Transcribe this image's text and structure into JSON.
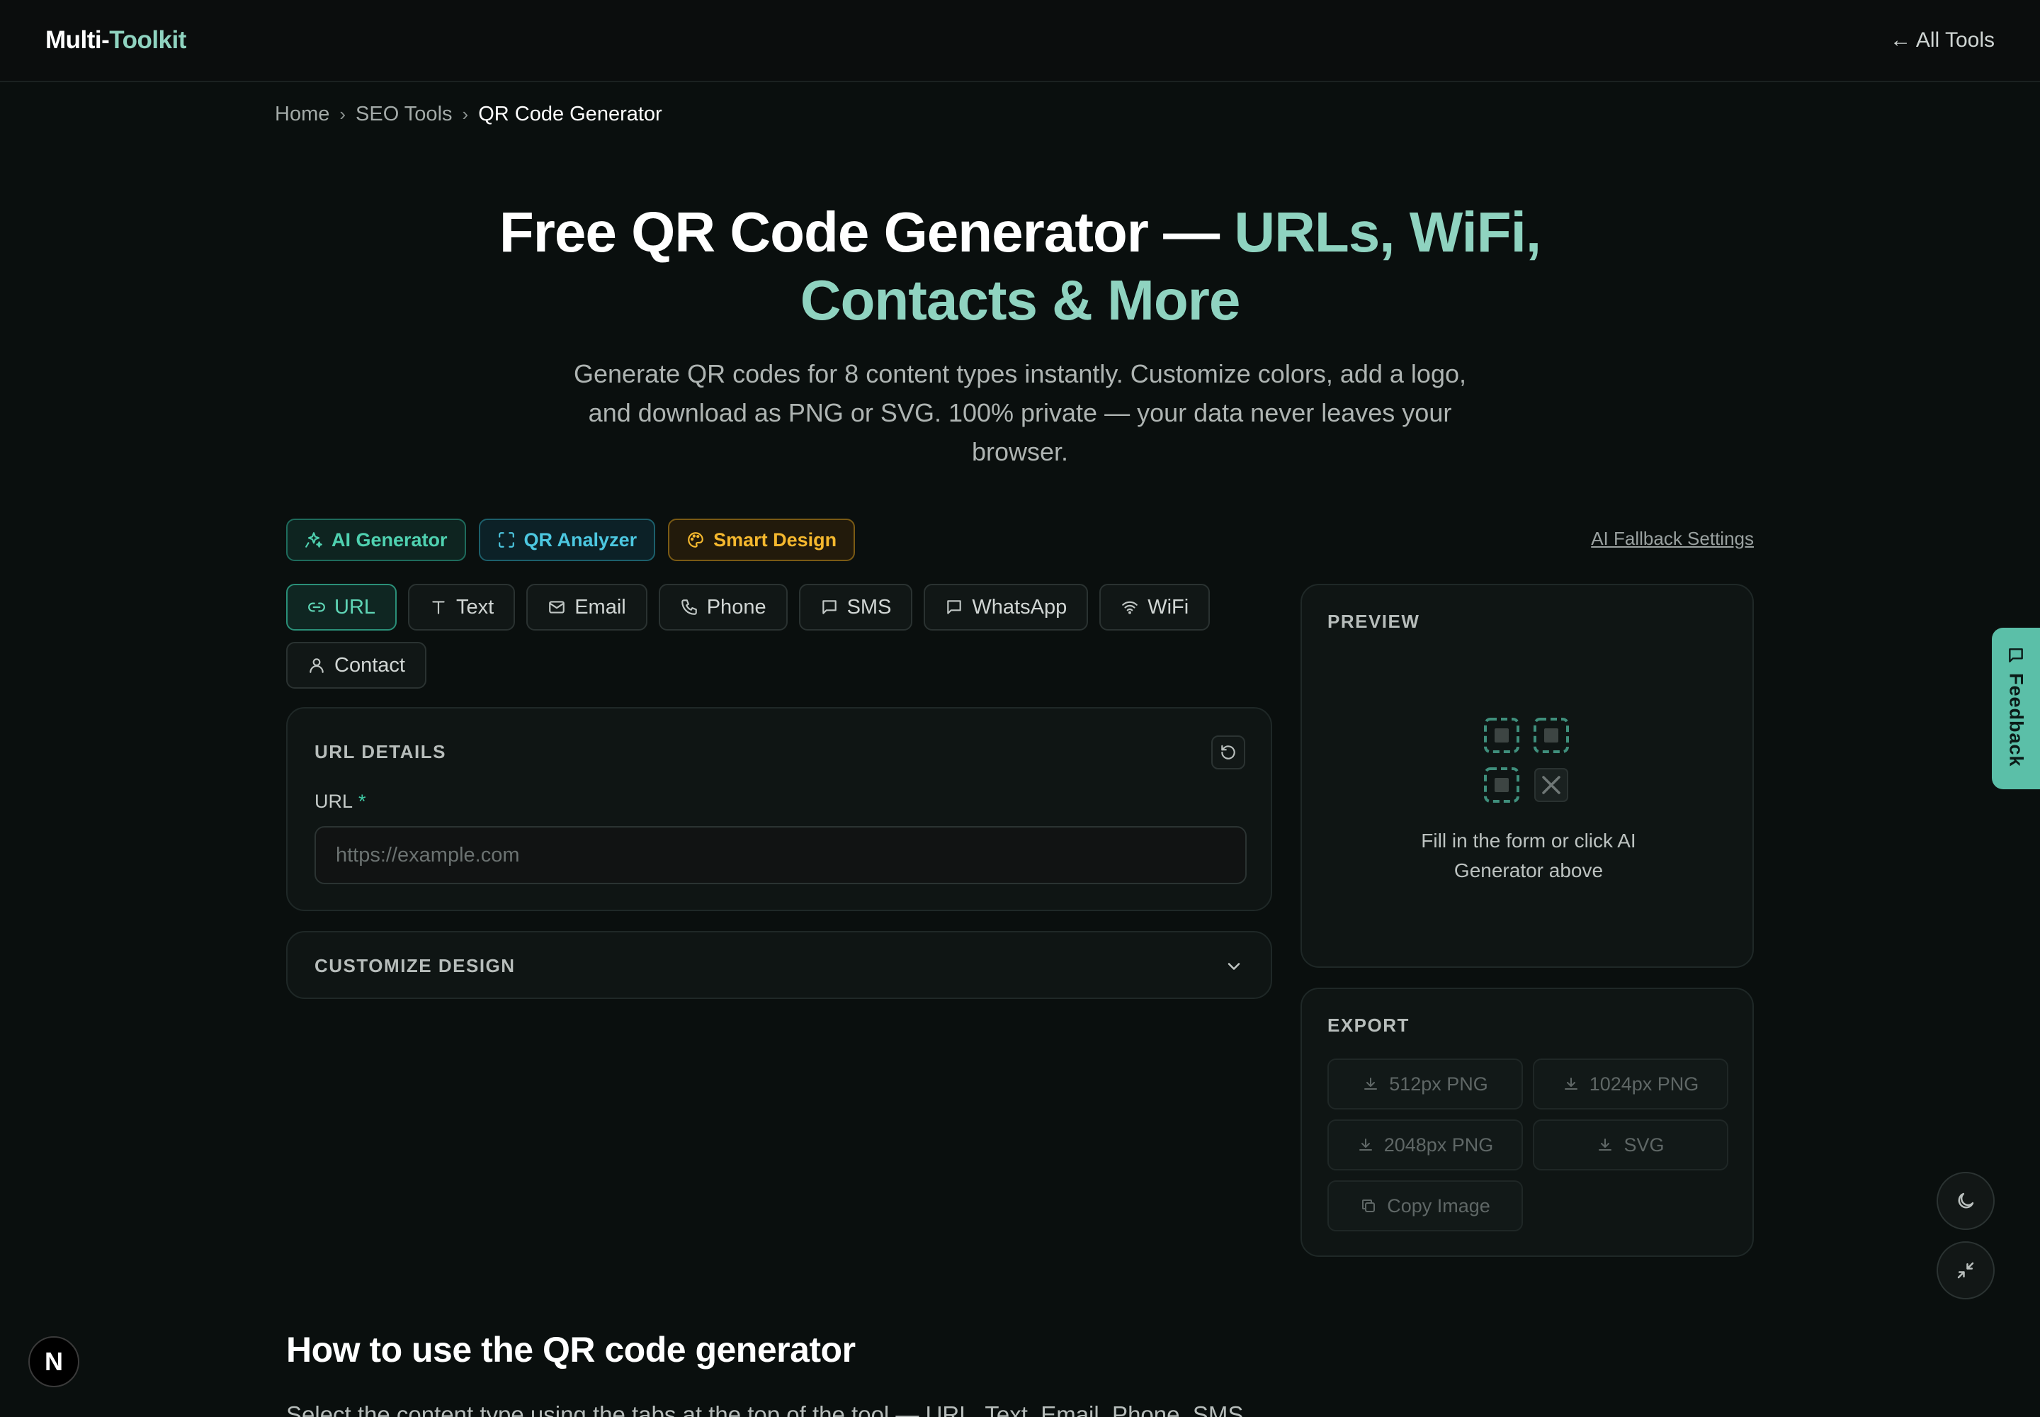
{
  "header": {
    "brand_part1": "Multi-",
    "brand_part2": "Toolkit",
    "all_tools": "← All Tools"
  },
  "breadcrumb": {
    "items": [
      "Home",
      "SEO Tools",
      "QR Code Generator"
    ],
    "separator": "›"
  },
  "hero": {
    "title_white": "Free QR Code Generator — ",
    "title_green_1": "URLs, WiFi,",
    "title_green_2": "Contacts & More",
    "subtitle": "Generate QR codes for 8 content types instantly. Customize colors, add a logo, and download as PNG or SVG. 100% private — your data never leaves your browser."
  },
  "features": {
    "ai_generator": "AI Generator",
    "qr_analyzer": "QR Analyzer",
    "smart_design": "Smart Design",
    "fallback_settings": "AI Fallback Settings"
  },
  "tabs": [
    {
      "label": "URL",
      "icon": "link-icon",
      "active": true
    },
    {
      "label": "Text",
      "icon": "text-icon",
      "active": false
    },
    {
      "label": "Email",
      "icon": "mail-icon",
      "active": false
    },
    {
      "label": "Phone",
      "icon": "phone-icon",
      "active": false
    },
    {
      "label": "SMS",
      "icon": "message-icon",
      "active": false
    },
    {
      "label": "WhatsApp",
      "icon": "chat-icon",
      "active": false
    },
    {
      "label": "WiFi",
      "icon": "wifi-icon",
      "active": false
    },
    {
      "label": "Contact",
      "icon": "user-icon",
      "active": false
    }
  ],
  "url_details": {
    "title": "URL DETAILS",
    "field_label": "URL",
    "required_mark": "*",
    "placeholder": "https://example.com",
    "value": ""
  },
  "customize": {
    "title": "CUSTOMIZE DESIGN"
  },
  "preview": {
    "title": "PREVIEW",
    "message": "Fill in the form or click AI Generator above"
  },
  "export": {
    "title": "EXPORT",
    "buttons": [
      "512px PNG",
      "1024px PNG",
      "2048px PNG",
      "SVG",
      "Copy Image"
    ]
  },
  "feedback": {
    "label": "Feedback"
  },
  "badge": {
    "letter": "N"
  },
  "howto": {
    "title": "How to use the QR code generator",
    "text": "Select the content type using the tabs at the top of the tool — URL, Text, Email, Phone, SMS,"
  },
  "colors": {
    "accent": "#5fd6b6",
    "brand_green": "#8fd3c0",
    "feedback_bg": "#5bbfa8",
    "smart_design": "#f5b82e",
    "analyzer": "#4cc7e0"
  }
}
